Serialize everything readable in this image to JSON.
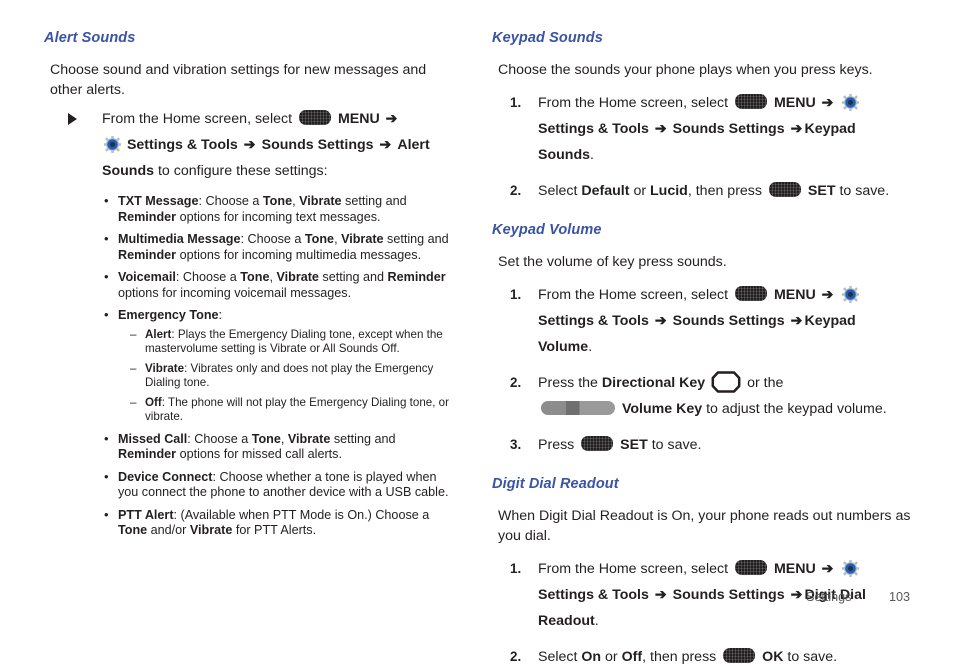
{
  "page": {
    "footer_label": "Settings",
    "footer_page_number": "103",
    "heading_color": "#3a53a4",
    "text_color": "#231f20"
  },
  "icons": {
    "menu_key": "menu-key-glyph",
    "settings_gear": "gear-icon",
    "directional_key": "directional-key-glyph",
    "volume_key": "volume-key-glyph",
    "arrow": "➔",
    "triangle_bullet": "triangle-bullet-icon"
  },
  "left_column": {
    "section": {
      "heading": "Alert Sounds",
      "intro": "Choose sound and vibration settings for new messages and other alerts.",
      "step": {
        "lead": "From the Home screen, select",
        "menu_label": "MENU",
        "nav_1": "Settings & Tools",
        "nav_2": "Sounds Settings",
        "nav_3": "Alert Sounds",
        "tail": "to configure these settings:"
      },
      "bullets": [
        {
          "term": "TXT Message",
          "parts": [
            ": Choose a ",
            "Tone",
            ", ",
            "Vibrate",
            " setting and ",
            "Reminder",
            " options for incoming text messages."
          ]
        },
        {
          "term": "Multimedia Message",
          "parts": [
            ": Choose a ",
            "Tone",
            ", ",
            "Vibrate",
            " setting and ",
            "Reminder",
            " options for incoming multimedia messages."
          ]
        },
        {
          "term": "Voicemail",
          "parts": [
            ": Choose a ",
            "Tone",
            ", ",
            "Vibrate",
            " setting and ",
            "Reminder",
            " options for incoming voicemail messages."
          ]
        },
        {
          "term": "Emergency Tone",
          "parts": [
            ":"
          ],
          "sub_bullets": [
            {
              "term": "Alert",
              "text": ": Plays the Emergency Dialing tone, except when the mastervolume setting is Vibrate or All Sounds Off."
            },
            {
              "term": "Vibrate",
              "text": ": Vibrates only and does not play the Emergency Dialing tone."
            },
            {
              "term": "Off",
              "text": ": The phone will not play the Emergency Dialing tone, or vibrate."
            }
          ]
        },
        {
          "term": "Missed Call",
          "parts": [
            ": Choose a ",
            "Tone",
            ", ",
            "Vibrate",
            " setting and ",
            "Reminder",
            " options for missed call alerts."
          ]
        },
        {
          "term": "Device Connect",
          "parts": [
            ": Choose whether a tone is played when you connect the phone to another device with a USB cable."
          ]
        },
        {
          "term": "PTT Alert",
          "parts": [
            ": (Available when PTT Mode is On.) Choose a ",
            "Tone",
            " and/or ",
            "Vibrate",
            " for PTT Alerts."
          ]
        }
      ]
    }
  },
  "right_column": {
    "sections": [
      {
        "heading": "Keypad Sounds",
        "intro": "Choose the sounds your phone plays when you press keys.",
        "steps": [
          {
            "number": "1.",
            "lead": "From the Home screen, select",
            "menu_label": "MENU",
            "nav_1": "Settings & Tools",
            "nav_2": "Sounds Settings",
            "nav_3": "Keypad Sounds",
            "period": "."
          },
          {
            "number": "2.",
            "lead": "Select",
            "option_1": "Default",
            "or": "or",
            "option_2": "Lucid",
            "mid": ", then press",
            "key_label": "SET",
            "tail": "to save."
          }
        ]
      },
      {
        "heading": "Keypad Volume",
        "intro": "Set the volume of key press sounds.",
        "steps": [
          {
            "number": "1.",
            "lead": "From the Home screen, select",
            "menu_label": "MENU",
            "nav_1": "Settings & Tools",
            "nav_2": "Sounds Settings",
            "nav_3": "Keypad Volume",
            "period": "."
          },
          {
            "number": "2.",
            "lead": "Press the",
            "dir_key_label": "Directional Key",
            "mid": "or the",
            "vol_key_label": "Volume Key",
            "tail": "to adjust the keypad volume."
          },
          {
            "number": "3.",
            "lead": "Press",
            "key_label": "SET",
            "tail": "to save."
          }
        ]
      },
      {
        "heading": "Digit Dial Readout",
        "intro": "When Digit Dial Readout is On, your phone reads out numbers as you dial.",
        "steps": [
          {
            "number": "1.",
            "lead": "From the Home screen, select",
            "menu_label": "MENU",
            "nav_1": "Settings & Tools",
            "nav_2": "Sounds Settings",
            "nav_3": "Digit Dial Readout",
            "period": "."
          },
          {
            "number": "2.",
            "lead": "Select",
            "option_1": "On",
            "or": "or",
            "option_2": "Off",
            "mid": ", then press",
            "key_label": "OK",
            "tail": "to save."
          }
        ]
      }
    ]
  }
}
